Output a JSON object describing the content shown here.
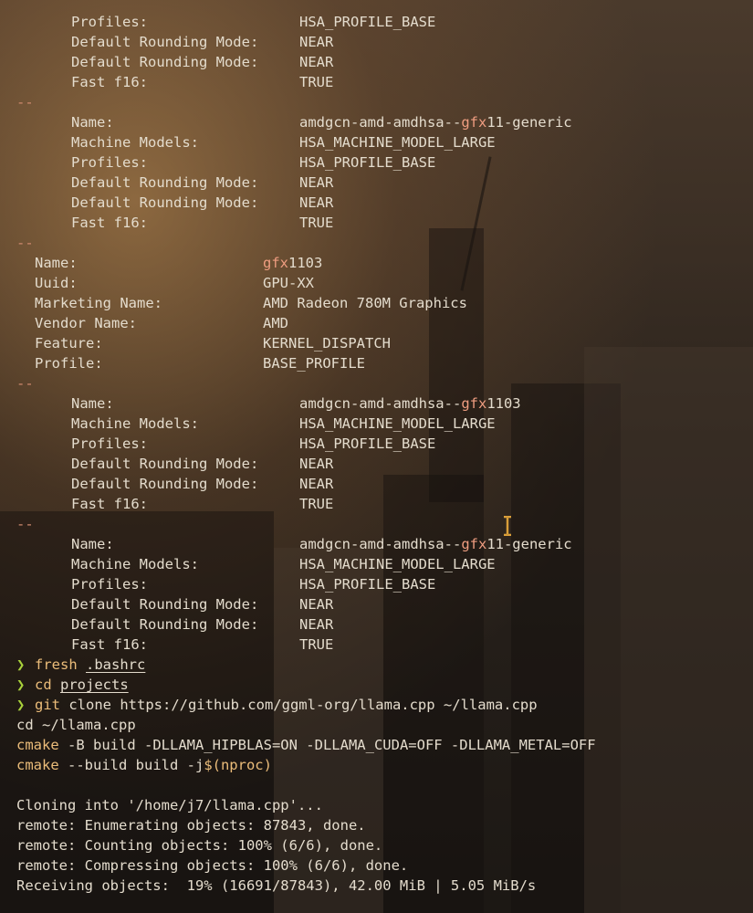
{
  "colors": {
    "text": "#e4dccd",
    "separator": "#d08a6f",
    "highlight": "#ef9d80",
    "prompt": "#a9d13b",
    "command": "#ecbd7a",
    "cursor": "#f0b040"
  },
  "icons": {
    "cursor": "text-cursor-ibeam-icon"
  },
  "terminal": {
    "block1": {
      "profiles_label": "Profiles:",
      "profiles_value": "HSA_PROFILE_BASE",
      "rounding1_label": "Default Rounding Mode:",
      "rounding1_value": "NEAR",
      "rounding2_label": "Default Rounding Mode:",
      "rounding2_value": "NEAR",
      "fast_label": "Fast f16:",
      "fast_value": "TRUE"
    },
    "sep": "--",
    "isa1": {
      "name_label": "Name:",
      "name_pre": "amdgcn-amd-amdhsa--",
      "name_hl": "gfx",
      "name_post": "11-generic",
      "machine_label": "Machine Models:",
      "machine_value": "HSA_MACHINE_MODEL_LARGE",
      "profiles_label": "Profiles:",
      "profiles_value": "HSA_PROFILE_BASE",
      "rounding1_label": "Default Rounding Mode:",
      "rounding1_value": "NEAR",
      "rounding2_label": "Default Rounding Mode:",
      "rounding2_value": "NEAR",
      "fast_label": "Fast f16:",
      "fast_value": "TRUE"
    },
    "agent": {
      "name_label": "Name:",
      "name_hl": "gfx",
      "name_post": "1103",
      "uuid_label": "Uuid:",
      "uuid_value": "GPU-XX",
      "marketing_label": "Marketing Name:",
      "marketing_value": "AMD Radeon 780M Graphics",
      "vendor_label": "Vendor Name:",
      "vendor_value": "AMD",
      "feature_label": "Feature:",
      "feature_value": "KERNEL_DISPATCH",
      "profile_label": "Profile:",
      "profile_value": "BASE_PROFILE"
    },
    "isa2": {
      "name_label": "Name:",
      "name_pre": "amdgcn-amd-amdhsa--",
      "name_hl": "gfx",
      "name_post": "1103",
      "machine_label": "Machine Models:",
      "machine_value": "HSA_MACHINE_MODEL_LARGE",
      "profiles_label": "Profiles:",
      "profiles_value": "HSA_PROFILE_BASE",
      "rounding1_label": "Default Rounding Mode:",
      "rounding1_value": "NEAR",
      "rounding2_label": "Default Rounding Mode:",
      "rounding2_value": "NEAR",
      "fast_label": "Fast f16:",
      "fast_value": "TRUE"
    },
    "isa3": {
      "name_label": "Name:",
      "name_pre": "amdgcn-amd-amdhsa--",
      "name_hl": "gfx",
      "name_post": "11-generic",
      "machine_label": "Machine Models:",
      "machine_value": "HSA_MACHINE_MODEL_LARGE",
      "profiles_label": "Profiles:",
      "profiles_value": "HSA_PROFILE_BASE",
      "rounding1_label": "Default Rounding Mode:",
      "rounding1_value": "NEAR",
      "rounding2_label": "Default Rounding Mode:",
      "rounding2_value": "NEAR",
      "fast_label": "Fast f16:",
      "fast_value": "TRUE"
    },
    "prompt_symbol": "❯",
    "cmd1": {
      "cmd": "fresh",
      "arg": ".bashrc"
    },
    "cmd2": {
      "cmd": "cd",
      "arg": "projects"
    },
    "cmd3": {
      "cmd": "git",
      "rest": " clone https://github.com/ggml-org/llama.cpp ~/llama.cpp"
    },
    "cont1": {
      "cmd": "cd",
      "rest": " ~/llama.cpp"
    },
    "cont2": {
      "cmd": "cmake",
      "rest": " -B build -DLLAMA_HIPBLAS=ON -DLLAMA_CUDA=OFF -DLLAMA_METAL=OFF"
    },
    "cont3": {
      "cmd": "cmake",
      "rest": " --build build -j",
      "subst": "$(nproc)"
    },
    "output": {
      "cloning": "Cloning into '/home/j7/llama.cpp'...",
      "enumerating": "remote: Enumerating objects: 87843, done.",
      "counting": "remote: Counting objects: 100% (6/6), done.",
      "compressing": "remote: Compressing objects: 100% (6/6), done.",
      "receiving": "Receiving objects:  19% (16691/87843), 42.00 MiB | 5.05 MiB/s"
    }
  }
}
